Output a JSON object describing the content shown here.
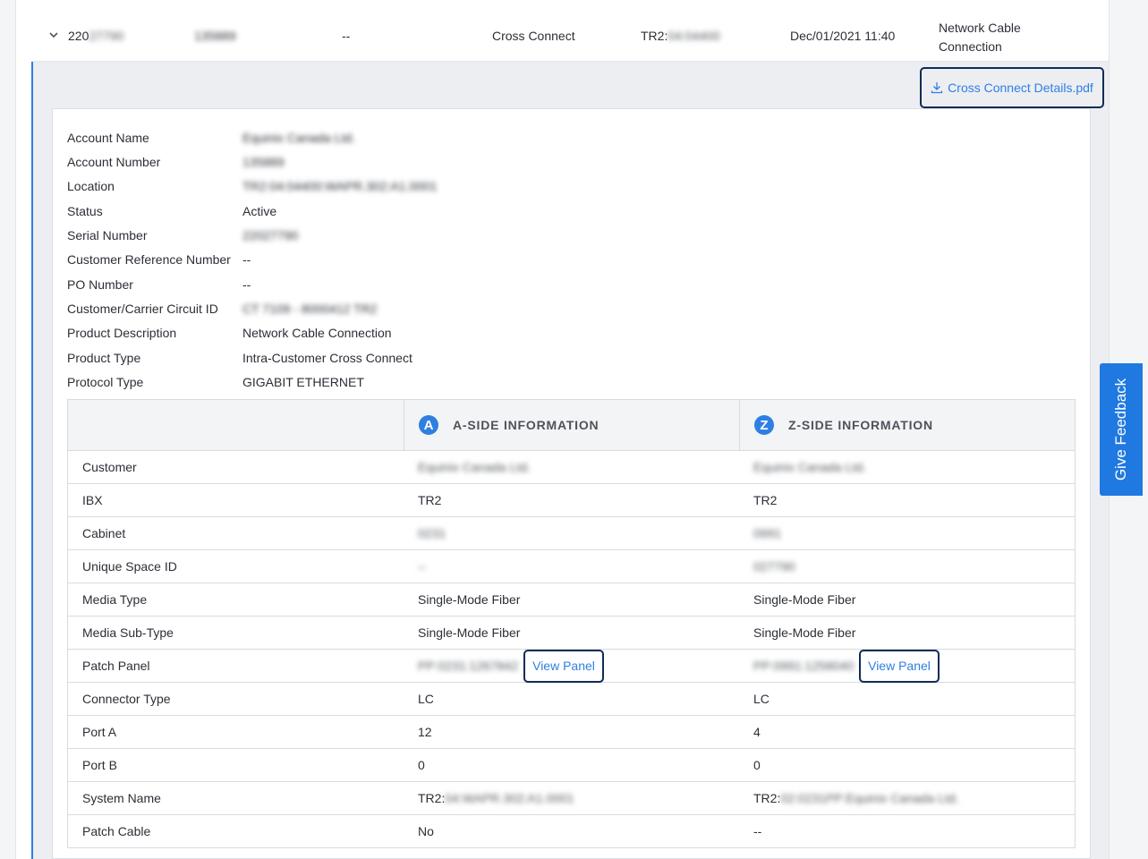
{
  "summary_row": {
    "id_prefix": "220",
    "id_rest": "27790",
    "account": "135889",
    "ref": "--",
    "type": "Cross Connect",
    "location_prefix": "TR2:",
    "location_rest": "04:04400",
    "date": "Dec/01/2021 11:40",
    "product_line1": "Network Cable",
    "product_line2": "Connection"
  },
  "pdf_button": {
    "label": "Cross Connect Details.pdf",
    "icon": "download-icon"
  },
  "details": [
    {
      "key": "Account Name",
      "value": "Equinix Canada Ltd.",
      "blurred": true
    },
    {
      "key": "Account Number",
      "value": "135889",
      "blurred": true
    },
    {
      "key": "Location",
      "value": "TR2:04:04400:WAPR.302:A1.0001",
      "blurred": true
    },
    {
      "key": "Status",
      "value": "Active",
      "blurred": false
    },
    {
      "key": "Serial Number",
      "value": "22027790",
      "blurred": true
    },
    {
      "key": "Customer Reference Number",
      "value": "--",
      "blurred": false
    },
    {
      "key": "PO Number",
      "value": "--",
      "blurred": false
    },
    {
      "key": "Customer/Carrier Circuit ID",
      "value": "CT 7109 - 8000412 TR2",
      "blurred": true
    },
    {
      "key": "Product Description",
      "value": "Network Cable Connection",
      "blurred": false
    },
    {
      "key": "Product Type",
      "value": "Intra-Customer Cross Connect",
      "blurred": false
    },
    {
      "key": "Protocol Type",
      "value": "GIGABIT ETHERNET",
      "blurred": false
    }
  ],
  "side_table": {
    "a_badge": "A",
    "a_title": "A-SIDE INFORMATION",
    "z_badge": "Z",
    "z_title": "Z-SIDE INFORMATION",
    "view_panel_label": "View Panel",
    "rows": [
      {
        "label": "Customer",
        "a": "Equinix Canada Ltd.",
        "a_blur": true,
        "z": "Equinix Canada Ltd.",
        "z_blur": true
      },
      {
        "label": "IBX",
        "a": "TR2",
        "a_blur": false,
        "z": "TR2",
        "z_blur": false
      },
      {
        "label": "Cabinet",
        "a": "0231",
        "a_blur": true,
        "z": "0991",
        "z_blur": true
      },
      {
        "label": "Unique Space ID",
        "a": "--",
        "a_blur": true,
        "z": "027790",
        "z_blur": true
      },
      {
        "label": "Media Type",
        "a": "Single-Mode Fiber",
        "a_blur": false,
        "z": "Single-Mode Fiber",
        "z_blur": false
      },
      {
        "label": "Media Sub-Type",
        "a": "Single-Mode Fiber",
        "a_blur": false,
        "z": "Single-Mode Fiber",
        "z_blur": false
      },
      {
        "label": "Patch Panel",
        "a": "PP:0231:1267842",
        "a_blur": true,
        "z": "PP:0991:1258040",
        "z_blur": true,
        "has_button": true
      },
      {
        "label": "Connector Type",
        "a": "LC",
        "a_blur": false,
        "z": "LC",
        "z_blur": false
      },
      {
        "label": "Port A",
        "a": "12",
        "a_blur": false,
        "z": "4",
        "z_blur": false
      },
      {
        "label": "Port B",
        "a": "0",
        "a_blur": false,
        "z": "0",
        "z_blur": false
      },
      {
        "label": "System Name",
        "a": "TR2:",
        "a_rest": "04:WAPR.302:A1.0001",
        "a_blur": false,
        "z": "TR2:",
        "z_rest": "02:0231PP:Equinix Canada Ltd.",
        "z_blur": false
      },
      {
        "label": "Patch Cable",
        "a": "No",
        "a_blur": false,
        "z": "--",
        "z_blur": false
      }
    ]
  },
  "feedback_tab": {
    "label": "Give Feedback"
  }
}
